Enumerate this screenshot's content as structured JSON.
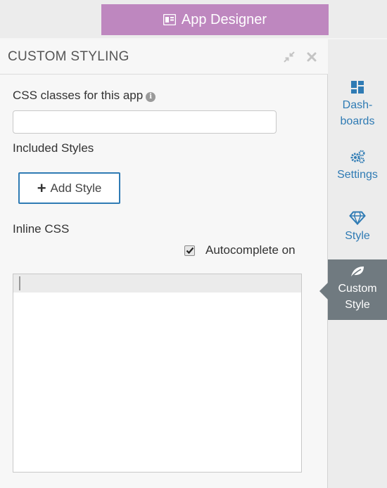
{
  "topbar": {
    "app_designer_label": "App Designer",
    "accent": "#be87bf"
  },
  "panel": {
    "title": "CUSTOM STYLING",
    "css_classes_label": "CSS classes for this app",
    "css_classes_value": "",
    "css_classes_placeholder": "",
    "included_styles_label": "Included Styles",
    "add_style_label": "Add Style",
    "inline_css_label": "Inline CSS",
    "autocomplete_label": "Autocomplete on",
    "autocomplete_checked": true
  },
  "sidebar": {
    "items": [
      {
        "line1": "Dash-",
        "line2": "boards",
        "icon": "dashboards-icon"
      },
      {
        "line1": "Settings",
        "line2": "",
        "icon": "cogs-icon"
      },
      {
        "line1": "Style",
        "line2": "",
        "icon": "diamond-icon"
      },
      {
        "line1": "Custom",
        "line2": "Style",
        "icon": "leaf-icon",
        "active": true
      }
    ],
    "link_color": "#2f7bb4",
    "active_bg": "#707a80"
  }
}
